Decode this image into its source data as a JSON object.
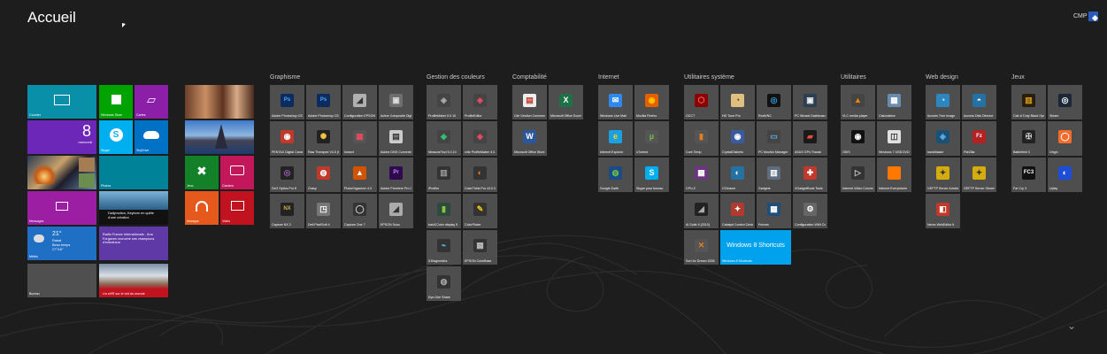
{
  "start": {
    "title": "Accueil",
    "user": "CMP"
  },
  "start_tiles": {
    "courrier": "Courrier",
    "store": "Windows Store",
    "cartes": "Cartes",
    "calendar_num": "8",
    "calendar_day": "mercredi",
    "skype": "Skype",
    "skydrive": "SkyDrive",
    "photos": "Photos",
    "messages": "Messages",
    "news": "Dailymotion, Keyborn en quête d'une création",
    "weather_temp": "21°",
    "weather_city": "Rabat",
    "weather_cond": "Beau temps",
    "weather_range": "27°/16°",
    "meteo": "Météo",
    "radio": "Radio France Internationale - Ana Forgaven recruche ses champions d'entraîneur",
    "bureau": "Bureau",
    "geo": "Un sHR sur le toit du monde",
    "jeux": "Jeux",
    "camera": "Caméra",
    "musique": "Musique",
    "video": "Vidéo"
  },
  "groups": [
    {
      "name": "Graphisme",
      "tiles": [
        {
          "label": "Adobe Photoshop CS5 (64 Bit)",
          "icon": "photoshop-icon",
          "bg": "#0c2b5e",
          "fg": "#4da6ff",
          "g": "Ps"
        },
        {
          "label": "Adobe Photoshop CS6 (64 Bit)",
          "icon": "photoshop-icon",
          "bg": "#0c2b5e",
          "fg": "#4da6ff",
          "g": "Ps"
        },
        {
          "label": "Configuration EPSON Scan",
          "icon": "scanner-icon",
          "bg": "#b0b0b0",
          "fg": "#333",
          "g": "◢"
        },
        {
          "label": "Active Composite Digi 1.0",
          "icon": "composite-icon",
          "bg": "#6e6e6e",
          "fg": "#ddd",
          "g": "▣"
        },
        {
          "label": "PENTAX Digital Camera Utility 4",
          "icon": "camera-icon",
          "bg": "#c0392b",
          "fg": "#fff",
          "g": "◉"
        },
        {
          "label": "Raw Therapee V4.0 (64Bit)",
          "icon": "raw-therapee-icon",
          "bg": "#222",
          "fg": "#f5c542",
          "g": "✺"
        },
        {
          "label": "Instant",
          "icon": "instant-icon",
          "bg": "#555",
          "fg": "#e84a5f",
          "g": "▦"
        },
        {
          "label": "Adobe DNG Converter",
          "icon": "dng-icon",
          "bg": "#ccc",
          "fg": "#333",
          "g": "▤"
        },
        {
          "label": "DxO Optics Pro 8",
          "icon": "dxo-icon",
          "bg": "#222",
          "fg": "#9b59b6",
          "g": "◎"
        },
        {
          "label": "Grasp",
          "icon": "grasp-icon",
          "bg": "#c0392b",
          "fg": "#fff",
          "g": "◍"
        },
        {
          "label": "PicturOrganizer 4.0",
          "icon": "organizer-icon",
          "bg": "#d35400",
          "fg": "#fff",
          "g": "▲"
        },
        {
          "label": "Adobe Premiere Pro CS6",
          "icon": "premiere-icon",
          "bg": "#2d0b4e",
          "fg": "#c58af9",
          "g": "Pr"
        },
        {
          "label": "Capture NX 2",
          "icon": "capture-nx-icon",
          "bg": "#222",
          "fg": "#d4b24c",
          "g": "NX"
        },
        {
          "label": "Defi PixelSoft 4",
          "icon": "pixel-icon",
          "bg": "#777",
          "fg": "#fff",
          "g": "◳"
        },
        {
          "label": "Capture One 7",
          "icon": "capture-one-icon",
          "bg": "#333",
          "fg": "#ccc",
          "g": "◯"
        },
        {
          "label": "EPSON Scan",
          "icon": "scanner-icon",
          "bg": "#aaa",
          "fg": "#333",
          "g": "◢"
        }
      ]
    },
    {
      "name": "Gestion des couleurs",
      "tiles": [
        {
          "label": "ProfileMaker 5.0.10",
          "icon": "profilemaker-icon",
          "bg": "#444",
          "fg": "#aaa",
          "g": "◈"
        },
        {
          "label": "ProfileEditor",
          "icon": "profileeditor-icon",
          "bg": "#444",
          "fg": "#e84a5f",
          "g": "◈"
        },
        {
          "label": "MeasureTool 5.0.10",
          "icon": "measuretool-icon",
          "bg": "#444",
          "fg": "#2ecc71",
          "g": "◈"
        },
        {
          "label": "xrite ProfileMaker 4.0.2",
          "icon": "xrite-icon",
          "bg": "#444",
          "fg": "#e84a5f",
          "g": "◈"
        },
        {
          "label": "iProfiler",
          "icon": "iprofiler-icon",
          "bg": "#333",
          "fg": "#999",
          "g": "▥"
        },
        {
          "label": "ColorThink Pro v3.0.3",
          "icon": "colorthink-icon",
          "bg": "#333",
          "fg": "#e67e22",
          "g": "◐"
        },
        {
          "label": "basICColor display 5",
          "icon": "basiccolor-icon",
          "bg": "#2e4a3a",
          "fg": "#8bc34a",
          "g": "▮"
        },
        {
          "label": "ColorPicker",
          "icon": "colorpicker-icon",
          "bg": "#333",
          "fg": "#f1c40f",
          "g": "✎"
        },
        {
          "label": "i1Diagnostics",
          "icon": "i1-icon",
          "bg": "#333",
          "fg": "#5dade2",
          "g": "⌁"
        },
        {
          "label": "EPSON ColorBase",
          "icon": "colorbase-icon",
          "bg": "#333",
          "fg": "#bbb",
          "g": "▦"
        },
        {
          "label": "Eye-One Share",
          "icon": "eyeone-icon",
          "bg": "#333",
          "fg": "#aaa",
          "g": "◍"
        }
      ]
    },
    {
      "name": "Comptabilité",
      "tiles": [
        {
          "label": "Ciel Gestion Commerciale",
          "icon": "ciel-icon",
          "bg": "#eee",
          "fg": "#c0392b",
          "g": "▤"
        },
        {
          "label": "Microsoft Office Excel 2007",
          "icon": "excel-icon",
          "bg": "#1e7145",
          "fg": "#fff",
          "g": "X"
        },
        {
          "label": "Microsoft Office Word 2007",
          "icon": "word-icon",
          "bg": "#2b579a",
          "fg": "#fff",
          "g": "W"
        }
      ]
    },
    {
      "name": "Internet",
      "tiles": [
        {
          "label": "Windows Live Mail",
          "icon": "live-mail-icon",
          "bg": "#2d89ef",
          "fg": "#fff",
          "g": "✉"
        },
        {
          "label": "Mozilla Firefox",
          "icon": "firefox-icon",
          "bg": "#e66000",
          "fg": "#ffcb00",
          "g": "◉"
        },
        {
          "label": "Internet Explorer",
          "icon": "ie-icon",
          "bg": "#1ba1e2",
          "fg": "#ffd700",
          "g": "e"
        },
        {
          "label": "uTorrent",
          "icon": "utorrent-icon",
          "bg": "#555",
          "fg": "#6bc04b",
          "g": "µ"
        },
        {
          "label": "Google Earth",
          "icon": "google-earth-icon",
          "bg": "#1c4a86",
          "fg": "#6bc04b",
          "g": "◍"
        },
        {
          "label": "Skype pour bureau",
          "icon": "skype-icon",
          "bg": "#00aff0",
          "fg": "#fff",
          "g": "S"
        }
      ]
    },
    {
      "name": "Utilitaires système",
      "tiles": [
        {
          "label": "OCCT",
          "icon": "occt-icon",
          "bg": "#8b0000",
          "fg": "#ff6666",
          "g": "⬡"
        },
        {
          "label": "HD Tune Pro",
          "icon": "hdtune-icon",
          "bg": "#e0c080",
          "fg": "#333",
          "g": "◔"
        },
        {
          "label": "RealVNC",
          "icon": "vnc-icon",
          "bg": "#111",
          "fg": "#3498db",
          "g": "◎"
        },
        {
          "label": "PC Wizard Dashboard",
          "icon": "pcwizard-icon",
          "bg": "#2c3e50",
          "fg": "#ecf0f1",
          "g": "▣"
        },
        {
          "label": "Core Temp",
          "icon": "coretemp-icon",
          "bg": "#555",
          "fg": "#e67e22",
          "g": "▮"
        },
        {
          "label": "CrystalDiskInfo",
          "icon": "crystaldisk-icon",
          "bg": "#3a5ba0",
          "fg": "#fff",
          "g": "◉"
        },
        {
          "label": "PC Monitor Manager",
          "icon": "pcmonitor-icon",
          "bg": "#444",
          "fg": "#5dade2",
          "g": "▭"
        },
        {
          "label": "ASUS GPU Tweak",
          "icon": "gputweak-icon",
          "bg": "#1a1a1a",
          "fg": "#e74c3c",
          "g": "▰"
        },
        {
          "label": "CPU-Z",
          "icon": "cpuz-icon",
          "bg": "#6c3483",
          "fg": "#fff",
          "g": "▦"
        },
        {
          "label": "CCleaner",
          "icon": "ccleaner-icon",
          "bg": "#2471a3",
          "fg": "#fff",
          "g": "◐"
        },
        {
          "label": "Gadgets",
          "icon": "gadgets-icon",
          "bg": "#5d6d7e",
          "fg": "#fff",
          "g": "▥"
        },
        {
          "label": "XGadgetBook Tools",
          "icon": "xgadget-icon",
          "bg": "#c0392b",
          "fg": "#fff",
          "g": "✚"
        },
        {
          "label": "AI Suite II (2010)",
          "icon": "aisuite-icon",
          "bg": "#222",
          "fg": "#aaa",
          "g": "◢"
        },
        {
          "label": "Catalyst Control Center",
          "icon": "catalyst-icon",
          "bg": "#b03a2e",
          "fg": "#fff",
          "g": "✦"
        },
        {
          "label": "Fences",
          "icon": "fences-icon",
          "bg": "#1f4e79",
          "fg": "#fff",
          "g": "▦"
        },
        {
          "label": "Configuration WMI Consol",
          "icon": "wmi-icon",
          "bg": "#666",
          "fg": "#fff",
          "g": "⚙"
        },
        {
          "label": "Sort for Dream 2008",
          "icon": "sort-icon",
          "bg": "#555",
          "fg": "#e67e22",
          "g": "✕"
        },
        {
          "label": "Windows 8 Shortcuts",
          "icon": "windows8-shortcuts-icon",
          "bg": "#00a2ed",
          "fg": "#fff",
          "g": "W8"
        }
      ]
    },
    {
      "name": "Utilitaires",
      "tiles": [
        {
          "label": "VLC media player",
          "icon": "vlc-icon",
          "bg": "#444",
          "fg": "#ff8800",
          "g": "▲"
        },
        {
          "label": "Calculatrice",
          "icon": "calculator-icon",
          "bg": "#6a8caf",
          "fg": "#fff",
          "g": "▦"
        },
        {
          "label": "OSIS",
          "icon": "osis-icon",
          "bg": "#111",
          "fg": "#fff",
          "g": "◉"
        },
        {
          "label": "Windows 7 USB DVD Download Tool",
          "icon": "usb-dvd-icon",
          "bg": "#e0e0e0",
          "fg": "#333",
          "g": "◫"
        },
        {
          "label": "Internet Video Converter 2.33.3",
          "icon": "video-converter-icon",
          "bg": "#333",
          "fg": "#ccc",
          "g": "▷"
        },
        {
          "label": "Internet Everywhere",
          "icon": "orange-icon",
          "bg": "#ff7900",
          "fg": "#ff7900",
          "g": "■"
        }
      ]
    },
    {
      "name": "Web design",
      "tiles": [
        {
          "label": "Acronis True Image",
          "icon": "acronis-icon",
          "bg": "#2e86c1",
          "fg": "#fff",
          "g": "◔"
        },
        {
          "label": "Acronis Disk Director",
          "icon": "disk-director-icon",
          "bg": "#2471a3",
          "fg": "#fff",
          "g": "◓"
        },
        {
          "label": "backMaster",
          "icon": "backmaster-icon",
          "bg": "#1a5276",
          "fg": "#5dade2",
          "g": "◈"
        },
        {
          "label": "FileZilla",
          "icon": "filezilla-icon",
          "bg": "#b22222",
          "fg": "#fff",
          "g": "Fz"
        },
        {
          "label": "GEFTP Server Administration",
          "icon": "geftp-icon",
          "bg": "#d4ac0d",
          "fg": "#333",
          "g": "✦"
        },
        {
          "label": "GEFTP Server Observation Tray",
          "icon": "geftp-tray-icon",
          "bg": "#d4ac0d",
          "fg": "#333",
          "g": "✦"
        },
        {
          "label": "Nemo WebEditor 8",
          "icon": "nemo-icon",
          "bg": "#c0392b",
          "fg": "#fff",
          "g": "◧"
        }
      ]
    },
    {
      "name": "Jeux",
      "tiles": [
        {
          "label": "Call of Duty Black Ops II - Multiplayer",
          "icon": "cod-icon",
          "bg": "#2b1d0e",
          "fg": "#d4a017",
          "g": "▥"
        },
        {
          "label": "Steam",
          "icon": "steam-icon",
          "bg": "#1b2838",
          "fg": "#fff",
          "g": "◎"
        },
        {
          "label": "Battlefield 3",
          "icon": "battlefield-icon",
          "bg": "#222",
          "fg": "#ccc",
          "g": "✠"
        },
        {
          "label": "Origin",
          "icon": "origin-icon",
          "bg": "#f56c2d",
          "fg": "#fff",
          "g": "◯"
        },
        {
          "label": "Far Cry 3",
          "icon": "farcry-icon",
          "bg": "#111",
          "fg": "#fff",
          "g": "FC3"
        },
        {
          "label": "Uplay",
          "icon": "uplay-icon",
          "bg": "#1d4ed8",
          "fg": "#fff",
          "g": "◐"
        }
      ]
    }
  ]
}
